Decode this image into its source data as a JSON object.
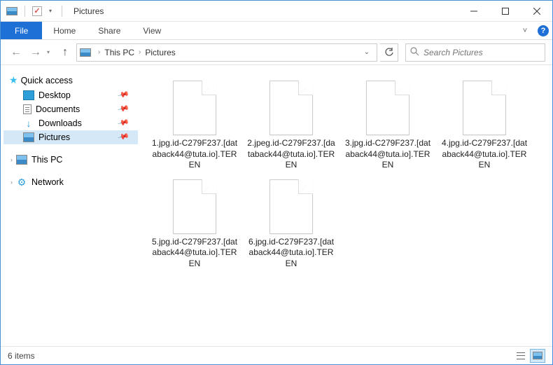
{
  "window": {
    "title": "Pictures"
  },
  "ribbon": {
    "file": "File",
    "tabs": [
      "Home",
      "Share",
      "View"
    ]
  },
  "breadcrumb": {
    "root": "This PC",
    "folder": "Pictures"
  },
  "search": {
    "placeholder": "Search Pictures"
  },
  "sidebar": {
    "quick_access": "Quick access",
    "items": [
      {
        "label": "Desktop"
      },
      {
        "label": "Documents"
      },
      {
        "label": "Downloads"
      },
      {
        "label": "Pictures"
      }
    ],
    "this_pc": "This PC",
    "network": "Network"
  },
  "files": [
    {
      "name": "1.jpg.id-C279F237.[databack44@tuta.io].TEREN"
    },
    {
      "name": "2.jpeg.id-C279F237.[databack44@tuta.io].TEREN"
    },
    {
      "name": "3.jpg.id-C279F237.[databack44@tuta.io].TEREN"
    },
    {
      "name": "4.jpg.id-C279F237.[databack44@tuta.io].TEREN"
    },
    {
      "name": "5.jpg.id-C279F237.[databack44@tuta.io].TEREN"
    },
    {
      "name": "6.jpg.id-C279F237.[databack44@tuta.io].TEREN"
    }
  ],
  "status": {
    "count": "6 items"
  }
}
